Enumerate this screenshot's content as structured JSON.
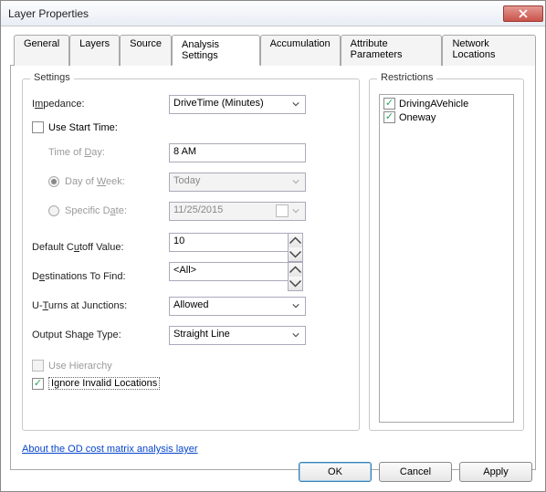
{
  "window": {
    "title": "Layer Properties"
  },
  "tabs": [
    "General",
    "Layers",
    "Source",
    "Analysis Settings",
    "Accumulation",
    "Attribute Parameters",
    "Network Locations"
  ],
  "active_tab": "Analysis Settings",
  "settings": {
    "legend": "Settings",
    "impedance": {
      "label_pre": "I",
      "label_u": "m",
      "label_post": "pedance:",
      "value": "DriveTime (Minutes)"
    },
    "use_start_time": {
      "label_pre": "Use ",
      "label_u": "S",
      "label_post": "tart Time:",
      "checked": false
    },
    "time_of_day": {
      "label_pre": "Time of ",
      "label_u": "D",
      "label_post": "ay:",
      "value": "8 AM"
    },
    "day_of_week": {
      "label_pre": "Day of ",
      "label_u": "W",
      "label_post": "eek:",
      "value": "Today",
      "selected": true
    },
    "specific_date": {
      "label_pre": "Specific D",
      "label_u": "a",
      "label_post": "te:",
      "value": "11/25/2015",
      "selected": false
    },
    "default_cutoff": {
      "label_pre": "Default C",
      "label_u": "u",
      "label_post": "toff Value:",
      "value": "10"
    },
    "destinations": {
      "label_pre": "D",
      "label_u": "e",
      "label_post": "stinations To Find:",
      "value": "<All>"
    },
    "uturns": {
      "label_pre": "U-",
      "label_u": "T",
      "label_post": "urns at Junctions:",
      "value": "Allowed"
    },
    "output_shape": {
      "label_pre": "Output Sha",
      "label_u": "p",
      "label_post": "e Type:",
      "value": "Straight Line"
    },
    "use_hierarchy": {
      "label_pre": "Use ",
      "label_u": "H",
      "label_post": "ierarchy",
      "checked": false
    },
    "ignore_invalid": {
      "label_pre": "I",
      "label_u": "g",
      "label_post": "nore Invalid Locations",
      "checked": true
    }
  },
  "restrictions": {
    "legend": "Restrictions",
    "items": [
      {
        "label": "DrivingAVehicle",
        "checked": true
      },
      {
        "label": "Oneway",
        "checked": true
      }
    ]
  },
  "link": "About the OD cost matrix analysis layer",
  "buttons": {
    "ok": "OK",
    "cancel": "Cancel",
    "apply": "Apply"
  }
}
